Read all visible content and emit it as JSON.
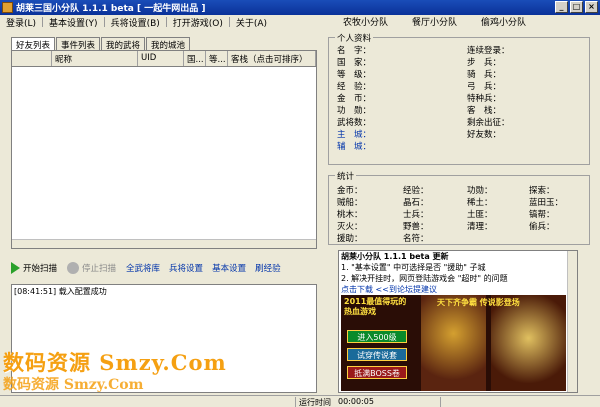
{
  "window": {
    "title": "胡莱三国小分队  1.1.1 beta [ 一起牛网出品 ]"
  },
  "menu": {
    "items": [
      "登录(L)",
      "基本设置(Y)",
      "兵将设置(B)",
      "打开游戏(O)",
      "关于(A)"
    ],
    "links": [
      "农牧小分队",
      "餐厅小分队",
      "偷鸡小分队"
    ]
  },
  "tabs": [
    "好友列表",
    "事件列表",
    "我的武将",
    "我的城池"
  ],
  "friend_table": {
    "columns": [
      "",
      "昵称",
      "UID",
      "国...",
      "等...",
      "客栈（点击可排序）"
    ]
  },
  "personal_info": {
    "legend": "个人资料",
    "left": [
      "名　字：",
      "国　家：",
      "等　级：",
      "经　验：",
      "金　币：",
      "功　勋：",
      "武将数：",
      "主　城：",
      "辅　城："
    ],
    "right": [
      "连续登录：",
      "步　兵：",
      "骑　兵：",
      "弓　兵：",
      "特种兵：",
      "客　栈：",
      "剩余出征：",
      "好友数："
    ],
    "link_color": "#0033aa"
  },
  "stats": {
    "legend": "统计",
    "rows": [
      [
        "金币：",
        "经验：",
        "功勋：",
        "探索："
      ],
      [
        "贼船：",
        "晶石：",
        "稀土：",
        "蓝田玉："
      ],
      [
        "桃木：",
        "士兵：",
        "土匪：",
        "镐帮："
      ],
      [
        "灭火：",
        "野兽：",
        "清理：",
        "偷兵："
      ],
      [
        "援助：",
        "名符：",
        "",
        ""
      ]
    ]
  },
  "toolbar": {
    "start": "开始扫描",
    "stop": "停止扫描",
    "links": [
      "全武将库",
      "兵将设置",
      "基本设置",
      "刷经验"
    ]
  },
  "log": {
    "rows": [
      {
        "time": "[08:41:51]",
        "text": "载入配置成功"
      }
    ]
  },
  "news": {
    "title": "胡莱小分队 1.1.1 beta 更新",
    "lines": [
      "1. \"基本设置\" 中可选择是否 \"援助\" 子城",
      "2. 解决开挂时，网页登陆游戏会 \"超时\" 的问题"
    ],
    "download": "点击下载",
    "forum": "<<到论坛提建议",
    "ad": {
      "title": "2011最值得玩的",
      "subtitle": "热血游戏",
      "title2": "天下齐争霸  传说影登场",
      "buttons": [
        "进入500级",
        "试穿传说套",
        "抵满BOSS卷"
      ]
    }
  },
  "status": {
    "label": "运行时间",
    "value": "00:00:05"
  },
  "watermark": {
    "line1": "数码资源 Smzy.Com",
    "line2": "数码资源 Smzy.Com"
  }
}
